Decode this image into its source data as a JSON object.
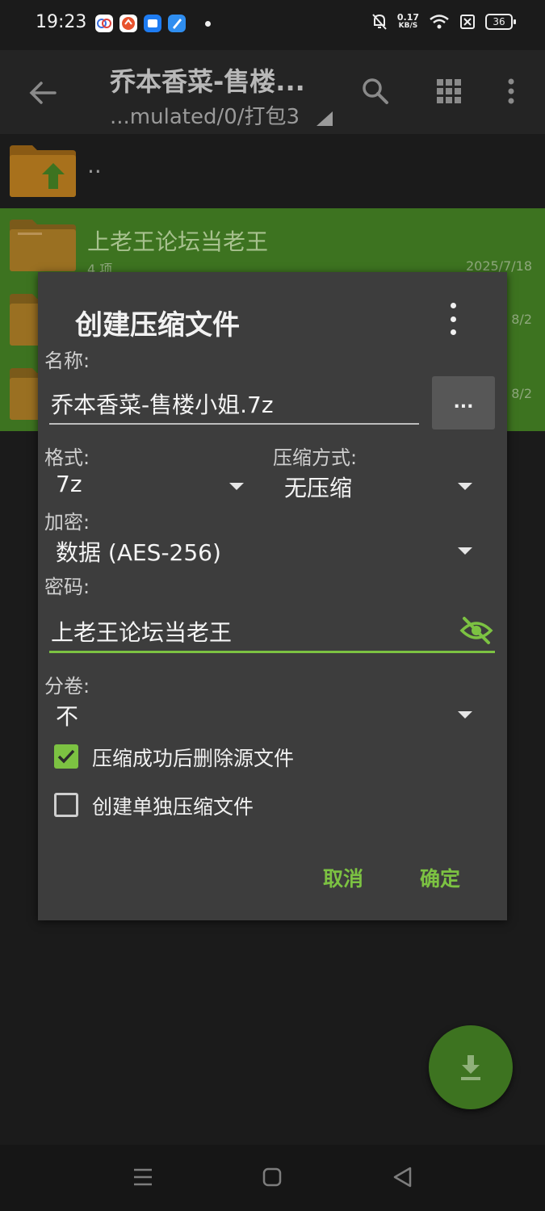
{
  "status_bar": {
    "time": "19:23",
    "net_speed_value": "0.17",
    "net_speed_unit": "KB/S",
    "battery": "36"
  },
  "toolbar": {
    "title": "乔本香菜-售楼...",
    "subtitle": "...mulated/0/打包3"
  },
  "file_list": {
    "parent_label": "..",
    "items": [
      {
        "name": "上老王论坛当老王",
        "meta": "4 项",
        "date": "2025/7/18"
      },
      {
        "date": "8/2"
      },
      {
        "date": "8/2"
      }
    ]
  },
  "dialog": {
    "title": "创建压缩文件",
    "name_label": "名称:",
    "name_value": "乔本香菜-售楼小姐.7z",
    "browse_label": "...",
    "format_label": "格式:",
    "format_value": "7z",
    "method_label": "压缩方式:",
    "method_value": "无压缩",
    "encrypt_label": "加密:",
    "encrypt_value": "数据 (AES-256)",
    "password_label": "密码:",
    "password_value": "上老王论坛当老王",
    "split_label": "分卷:",
    "split_value": "不",
    "delete_source_label": "压缩成功后删除源文件",
    "delete_source_checked": true,
    "separate_label": "创建单独压缩文件",
    "separate_checked": false,
    "cancel_label": "取消",
    "ok_label": "确定"
  },
  "colors": {
    "accent": "#7cc242",
    "selection": "#3d7320",
    "dialog_bg": "#3d3d3d",
    "background": "#1b1b1b"
  }
}
